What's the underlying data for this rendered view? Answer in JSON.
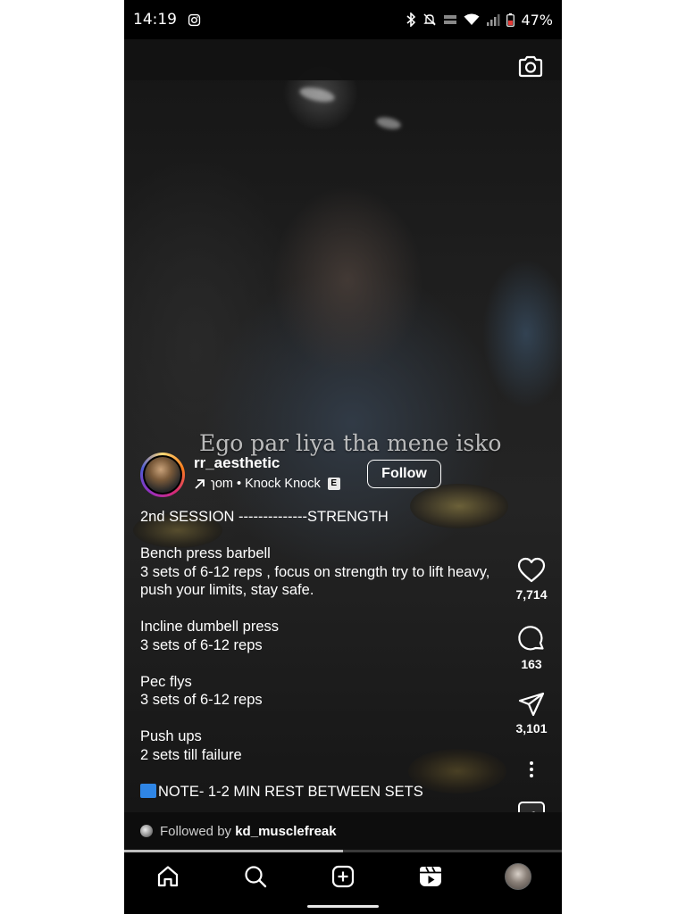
{
  "status_bar": {
    "time": "14:19",
    "battery": "47%",
    "icons": [
      "instagram-icon",
      "bluetooth-icon",
      "mute-icon",
      "vowifi-icon",
      "wifi-icon",
      "signal-icon",
      "battery-icon"
    ]
  },
  "reel": {
    "overlay_text": "Ego par liya tha mene isko",
    "username": "rr_aesthetic",
    "audio": {
      "text": "ɿom • Knock Knock",
      "explicit_badge": "E"
    },
    "follow_label": "Follow",
    "caption": [
      "2nd SESSION --------------STRENGTH",
      "Bench press barbell\n3 sets of 6-12 reps , focus on strength try to lift heavy, push your limits, stay safe.",
      "Incline dumbell press\n3 sets of 6-12 reps",
      "Pec flys\n3 sets of 6-12 reps",
      "Push ups\n2 sets till failure",
      "NOTE- 1-2 MIN REST BETWEEN SETS"
    ],
    "followed_by_prefix": "Followed by ",
    "followed_by_user": "kd_musclefreak",
    "progress": 0.5
  },
  "actions": {
    "likes": "7,714",
    "comments": "163",
    "shares": "3,101"
  },
  "bottom_nav": [
    "home-icon",
    "search-icon",
    "create-icon",
    "reels-icon",
    "profile-avatar"
  ],
  "colors": {
    "note_square": "#2f86e6",
    "background": "#000000"
  }
}
